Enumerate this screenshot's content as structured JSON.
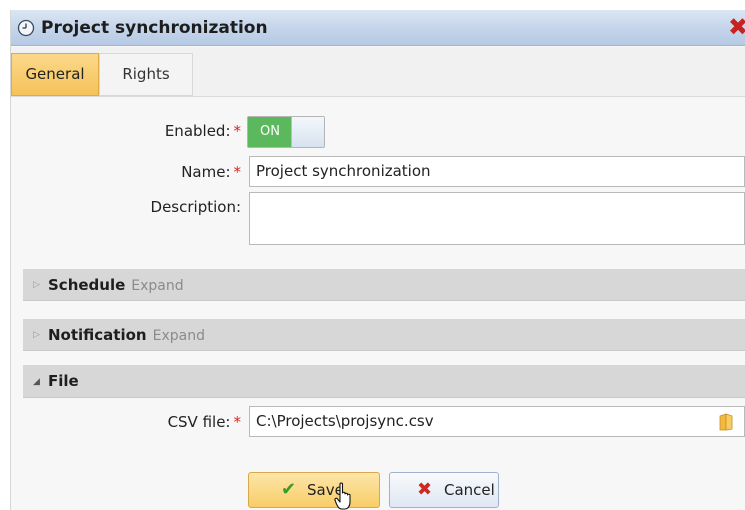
{
  "window": {
    "title": "Project synchronization"
  },
  "tabs": [
    {
      "label": "General",
      "active": true
    },
    {
      "label": "Rights",
      "active": false
    }
  ],
  "form": {
    "enabled": {
      "label": "Enabled:",
      "required_mark": "*",
      "toggle_text": "ON",
      "value": true
    },
    "name": {
      "label": "Name:",
      "required_mark": "*",
      "value": "Project synchronization"
    },
    "description": {
      "label": "Description:",
      "value": ""
    }
  },
  "sections": {
    "schedule": {
      "title": "Schedule",
      "action": "Expand",
      "expanded": false
    },
    "notification": {
      "title": "Notification",
      "action": "Expand",
      "expanded": false
    },
    "file": {
      "title": "File",
      "expanded": true
    }
  },
  "file": {
    "csv": {
      "label": "CSV file:",
      "required_mark": "*",
      "value": "C:\\Projects\\projsync.csv",
      "icon": "folder-icon"
    }
  },
  "buttons": {
    "save": {
      "label": "Save",
      "icon": "checkmark-icon"
    },
    "cancel": {
      "label": "Cancel",
      "icon": "x-icon"
    }
  },
  "colors": {
    "accent_tab": "#f5c25a",
    "toggle_on": "#5bb85d",
    "required": "#d9261c",
    "close": "#c9211e"
  }
}
